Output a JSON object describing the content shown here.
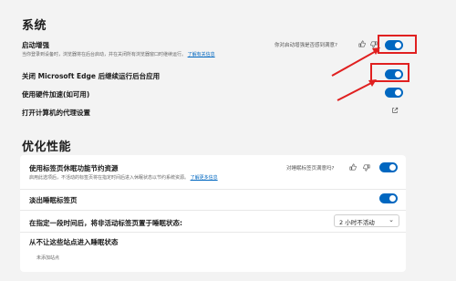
{
  "system": {
    "heading": "系统",
    "startup_boost": {
      "label": "启动增强",
      "description": "当你登录到设备时，浏览器将在后台启动，并在关闭所有浏览器窗口时继续运行。",
      "learn_more": "了解有关信息",
      "feedback_question": "你对启动增强是否感到满意?",
      "enabled": true
    },
    "background_apps": {
      "label": "关闭 Microsoft Edge 后继续运行后台应用",
      "enabled": true
    },
    "hardware_accel": {
      "label": "使用硬件加速(如可用)",
      "enabled": true
    },
    "proxy": {
      "label": "打开计算机的代理设置"
    }
  },
  "performance": {
    "heading": "优化性能",
    "sleeping_tabs": {
      "label": "使用标签页休眠功能节约资源",
      "description": "启用此选项后，不活动的标签页将在指定时间后进入休眠状态以节约系统资源。",
      "learn_more": "了解更多信息",
      "feedback_question": "对睡眠标签页满意吗?",
      "enabled": true
    },
    "fade_sleeping": {
      "label": "淡出睡眠标签页",
      "enabled": true
    },
    "sleep_after": {
      "label": "在指定一段时间后，将非活动标签页置于睡眠状态:",
      "selected": "2 小时不活动"
    },
    "never_sleep": {
      "label": "从不让这些站点进入睡眠状态",
      "empty_text": "未添加站点"
    }
  },
  "colors": {
    "accent": "#0067c0",
    "highlight": "#e02020",
    "background": "#f3f3f3"
  },
  "icons": [
    "thumbs-up-icon",
    "thumbs-down-icon",
    "external-link-icon",
    "chevron-down-icon"
  ]
}
